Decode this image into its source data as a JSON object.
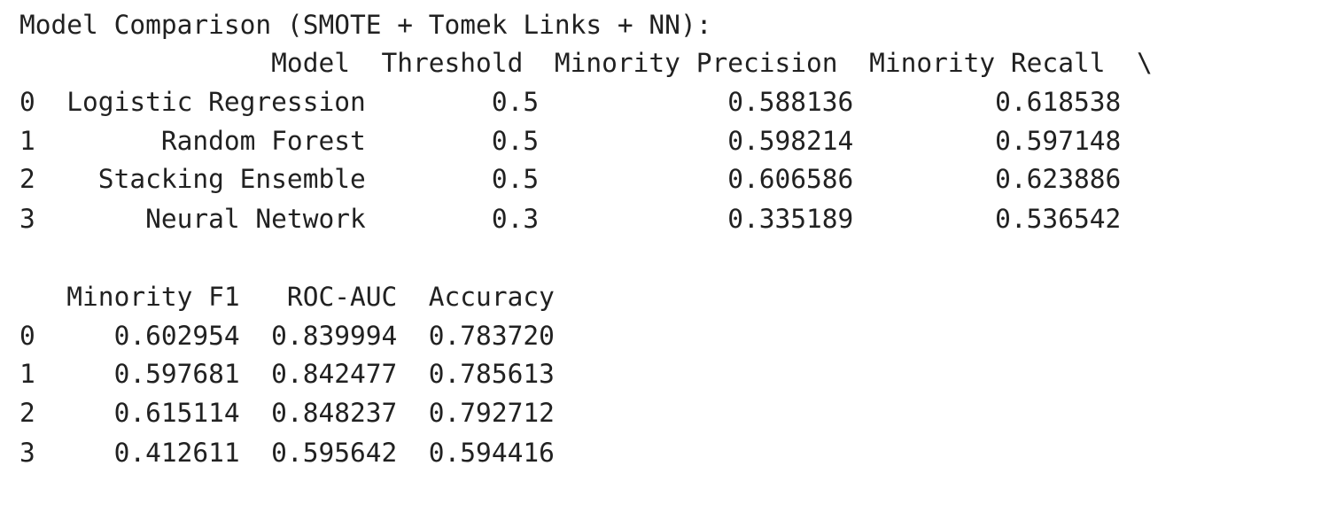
{
  "output": {
    "lines": [
      "Model Comparison (SMOTE + Tomek Links + NN):",
      "                Model  Threshold  Minority Precision  Minority Recall  \\",
      "0  Logistic Regression        0.5            0.588136         0.618538",
      "1        Random Forest        0.5            0.598214         0.597148",
      "2    Stacking Ensemble        0.5            0.606586         0.623886",
      "3       Neural Network        0.3            0.335189         0.536542",
      "",
      "   Minority F1   ROC-AUC  Accuracy",
      "0     0.602954  0.839994  0.783720",
      "1     0.597681  0.842477  0.785613",
      "2     0.615114  0.848237  0.792712",
      "3     0.412611  0.595642  0.594416"
    ]
  }
}
